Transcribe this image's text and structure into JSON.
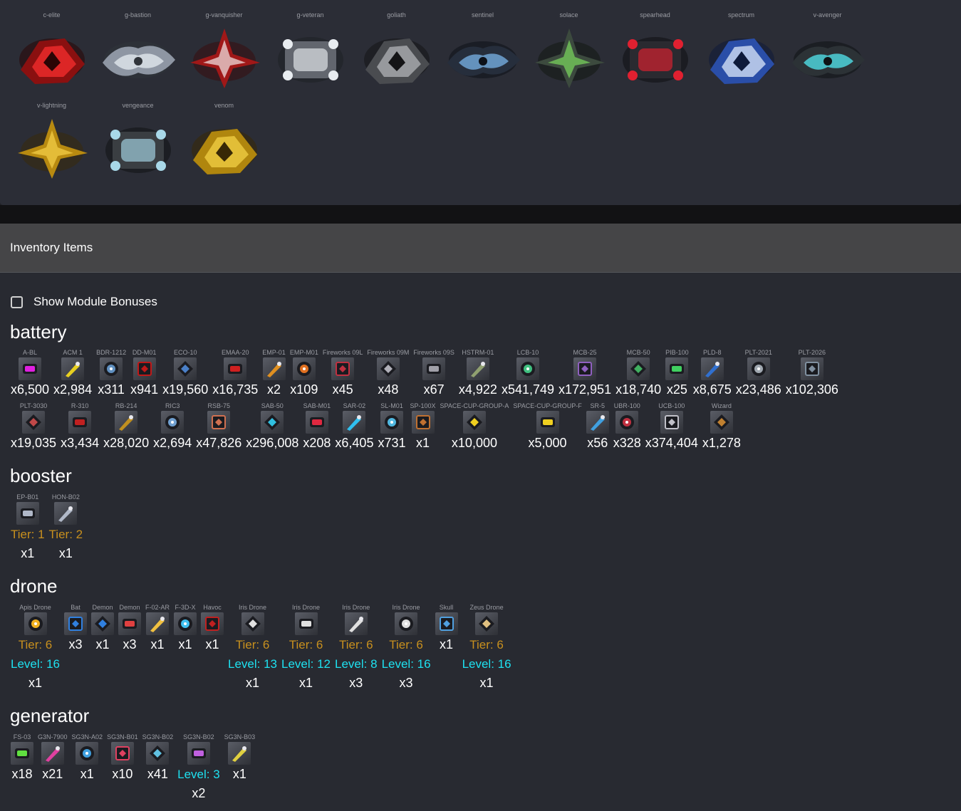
{
  "ships": [
    {
      "name": "c-elite",
      "colors": [
        "#8a1010",
        "#ff3030",
        "#2a0505"
      ],
      "icon": "ship-c-elite-icon"
    },
    {
      "name": "g-bastion",
      "colors": [
        "#8e96a3",
        "#e6ecf2",
        "#30343a"
      ],
      "icon": "ship-g-bastion-icon"
    },
    {
      "name": "g-vanquisher",
      "colors": [
        "#a01818",
        "#f2e8e8",
        "#3a0a0a"
      ],
      "icon": "ship-g-vanquisher-icon"
    },
    {
      "name": "g-veteran",
      "colors": [
        "#62666e",
        "#e8ecf0",
        "#1e2024"
      ],
      "icon": "ship-g-veteran-icon"
    },
    {
      "name": "goliath",
      "colors": [
        "#4a4c50",
        "#b8babe",
        "#141416"
      ],
      "icon": "ship-goliath-icon"
    },
    {
      "name": "sentinel",
      "colors": [
        "#262e3c",
        "#7ab4e8",
        "#0c1018"
      ],
      "icon": "ship-sentinel-icon"
    },
    {
      "name": "solace",
      "colors": [
        "#3c4a3e",
        "#7ad85e",
        "#10160e"
      ],
      "icon": "ship-solace-icon"
    },
    {
      "name": "spearhead",
      "colors": [
        "#2a2a30",
        "#e02030",
        "#0e0e12"
      ],
      "icon": "ship-spearhead-icon"
    },
    {
      "name": "spectrum",
      "colors": [
        "#2a4ea8",
        "#e8f2ff",
        "#0e1a3a"
      ],
      "icon": "ship-spectrum-icon"
    },
    {
      "name": "v-avenger",
      "colors": [
        "#2c3236",
        "#52e8f0",
        "#0e1214"
      ],
      "icon": "ship-v-avenger-icon"
    },
    {
      "name": "v-lightning",
      "colors": [
        "#b88a10",
        "#f6d24a",
        "#3a2a06"
      ],
      "icon": "ship-v-lightning-icon"
    },
    {
      "name": "vengeance",
      "colors": [
        "#3a3e42",
        "#a8d8e8",
        "#101214"
      ],
      "icon": "ship-vengeance-icon"
    },
    {
      "name": "venom",
      "colors": [
        "#b0860e",
        "#f8d648",
        "#382806"
      ],
      "icon": "ship-venom-icon"
    }
  ],
  "inventory": {
    "title": "Inventory Items",
    "show_bonuses_label": "Show Module Bonuses"
  },
  "categories": [
    {
      "title": "battery",
      "rows": [
        [
          {
            "name": "A-BL",
            "qty": "x6,500",
            "color": "#e020e0",
            "icon": "a-bl-icon"
          },
          {
            "name": "ACM 1",
            "qty": "x2,984",
            "color": "#e8d020",
            "icon": "acm-1-icon"
          },
          {
            "name": "BDR-1212",
            "qty": "x311",
            "color": "#6090c0",
            "icon": "bdr-1212-icon"
          },
          {
            "name": "DD-M01",
            "qty": "x941",
            "color": "#c01818",
            "icon": "dd-m01-icon"
          },
          {
            "name": "ECO-10",
            "qty": "x19,560",
            "color": "#4a80c8",
            "icon": "eco-10-icon"
          },
          {
            "name": "EMAA-20",
            "qty": "x16,735",
            "color": "#d02020",
            "icon": "emaa-20-icon"
          },
          {
            "name": "EMP-01",
            "qty": "x2",
            "color": "#e09020",
            "icon": "emp-01-icon"
          },
          {
            "name": "EMP-M01",
            "qty": "x109",
            "color": "#e07020",
            "icon": "emp-m01-icon"
          },
          {
            "name": "Fireworks 09L",
            "qty": "x45",
            "color": "#c03040",
            "icon": "fireworks-09l-icon"
          },
          {
            "name": "Fireworks 09M",
            "qty": "x48",
            "color": "#b0b0b8",
            "icon": "fireworks-09m-icon"
          },
          {
            "name": "Fireworks 09S",
            "qty": "x67",
            "color": "#a0a0a8",
            "icon": "fireworks-09s-icon"
          },
          {
            "name": "HSTRM-01",
            "qty": "x4,922",
            "color": "#90a070",
            "icon": "hstrm-01-icon"
          },
          {
            "name": "LCB-10",
            "qty": "x541,749",
            "color": "#40c080",
            "icon": "lcb-10-icon"
          },
          {
            "name": "MCB-25",
            "qty": "x172,951",
            "color": "#9060c0",
            "icon": "mcb-25-icon"
          },
          {
            "name": "MCB-50",
            "qty": "x18,740",
            "color": "#40b060",
            "icon": "mcb-50-icon"
          },
          {
            "name": "PIB-100",
            "qty": "x25",
            "color": "#40d060",
            "icon": "pib-100-icon"
          },
          {
            "name": "PLD-8",
            "qty": "x8,675",
            "color": "#3070d0",
            "icon": "pld-8-icon"
          },
          {
            "name": "PLT-2021",
            "qty": "x23,486",
            "color": "#a0a8b0",
            "icon": "plt-2021-icon"
          },
          {
            "name": "PLT-2026",
            "qty": "x102,306",
            "color": "#8090a0",
            "icon": "plt-2026-icon"
          }
        ],
        [
          {
            "name": "PLT-3030",
            "qty": "x19,035",
            "color": "#c04848",
            "icon": "plt-3030-icon"
          },
          {
            "name": "R-310",
            "qty": "x3,434",
            "color": "#c02020",
            "icon": "r-310-icon"
          },
          {
            "name": "RB-214",
            "qty": "x28,020",
            "color": "#c09020",
            "icon": "rb-214-icon"
          },
          {
            "name": "RIC3",
            "qty": "x2,694",
            "color": "#70a0d0",
            "icon": "ric3-icon"
          },
          {
            "name": "RSB-75",
            "qty": "x47,826",
            "color": "#d07050",
            "icon": "rsb-75-icon"
          },
          {
            "name": "SAB-50",
            "qty": "x296,008",
            "color": "#30c0e0",
            "icon": "sab-50-icon"
          },
          {
            "name": "SAB-M01",
            "qty": "x208",
            "color": "#e02840",
            "icon": "sab-m01-icon"
          },
          {
            "name": "SAR-02",
            "qty": "x6,405",
            "color": "#30c0f0",
            "icon": "sar-02-icon"
          },
          {
            "name": "SL-M01",
            "qty": "x731",
            "color": "#50b8e0",
            "icon": "sl-m01-icon"
          },
          {
            "name": "SP-100X",
            "qty": "x1",
            "color": "#c07030",
            "icon": "sp-100x-icon"
          },
          {
            "name": "SPACE-CUP-GROUP-A",
            "qty": "x10,000",
            "color": "#f0d020",
            "icon": "space-cup-group-a-icon"
          },
          {
            "name": "SPACE-CUP-GROUP-F",
            "qty": "x5,000",
            "color": "#f0d020",
            "icon": "space-cup-group-f-icon"
          },
          {
            "name": "SR-5",
            "qty": "x56",
            "color": "#40a0e0",
            "icon": "sr-5-icon"
          },
          {
            "name": "UBR-100",
            "qty": "x328",
            "color": "#c03040",
            "icon": "ubr-100-icon"
          },
          {
            "name": "UCB-100",
            "qty": "x374,404",
            "color": "#c0c0c8",
            "icon": "ucb-100-icon"
          },
          {
            "name": "Wizard",
            "qty": "x1,278",
            "color": "#c08030",
            "icon": "wizard-icon"
          }
        ]
      ]
    },
    {
      "title": "booster",
      "rows": [
        [
          {
            "name": "EP-B01",
            "tier": "Tier: 1",
            "qty": "x1",
            "color": "#b0b8c8",
            "icon": "ep-b01-icon"
          },
          {
            "name": "HON-B02",
            "tier": "Tier: 2",
            "qty": "x1",
            "color": "#b0b8c8",
            "icon": "hon-b02-icon"
          }
        ]
      ]
    },
    {
      "title": "drone",
      "rows": [
        [
          {
            "name": "Apis Drone",
            "tier": "Tier: 6",
            "level": "Level: 16",
            "qty": "x1",
            "color": "#f0b020",
            "icon": "apis-drone-icon"
          },
          {
            "name": "Bat",
            "qty": "x3",
            "color": "#3080e0",
            "icon": "bat-drone-icon"
          },
          {
            "name": "Demon",
            "qty": "x1",
            "color": "#3080e0",
            "icon": "demon-drone-icon"
          },
          {
            "name": "Demon",
            "qty": "x3",
            "color": "#e04040",
            "icon": "demon-red-drone-icon"
          },
          {
            "name": "F-02-AR",
            "qty": "x1",
            "color": "#f0c040",
            "icon": "f-02-ar-icon"
          },
          {
            "name": "F-3D-X",
            "qty": "x1",
            "color": "#40c0f0",
            "icon": "f-3d-x-icon"
          },
          {
            "name": "Havoc",
            "qty": "x1",
            "color": "#c02020",
            "icon": "havoc-icon"
          },
          {
            "name": "Iris Drone",
            "tier": "Tier: 6",
            "level": "Level: 13",
            "qty": "x1",
            "color": "#e0e0e0",
            "icon": "iris-drone-icon"
          },
          {
            "name": "Iris Drone",
            "tier": "Tier: 6",
            "level": "Level: 12",
            "qty": "x1",
            "color": "#e0e0e0",
            "icon": "iris-drone-icon"
          },
          {
            "name": "Iris Drone",
            "tier": "Tier: 6",
            "level": "Level: 8",
            "qty": "x3",
            "color": "#e0e0e0",
            "icon": "iris-drone-icon"
          },
          {
            "name": "Iris Drone",
            "tier": "Tier: 6",
            "level": "Level: 16",
            "qty": "x3",
            "color": "#e0e0e0",
            "icon": "iris-drone-icon"
          },
          {
            "name": "Skull",
            "qty": "x1",
            "color": "#50a0e0",
            "icon": "skull-drone-icon"
          },
          {
            "name": "Zeus Drone",
            "tier": "Tier: 6",
            "level": "Level: 16",
            "qty": "x1",
            "color": "#e0c080",
            "icon": "zeus-drone-icon"
          }
        ]
      ]
    },
    {
      "title": "generator",
      "rows": [
        [
          {
            "name": "FS-03",
            "qty": "x18",
            "color": "#60e040",
            "icon": "fs-03-icon"
          },
          {
            "name": "G3N-7900",
            "qty": "x21",
            "color": "#e040a0",
            "icon": "g3n-7900-icon"
          },
          {
            "name": "SG3N-A02",
            "qty": "x1",
            "color": "#40a0e0",
            "icon": "sg3n-a02-icon"
          },
          {
            "name": "SG3N-B01",
            "qty": "x10",
            "color": "#e04060",
            "icon": "sg3n-b01-icon"
          },
          {
            "name": "SG3N-B02",
            "qty": "x41",
            "color": "#60c0e0",
            "icon": "sg3n-b02-icon"
          },
          {
            "name": "SG3N-B02",
            "level": "Level: 3",
            "qty": "x2",
            "color": "#c060e0",
            "icon": "sg3n-b02-icon"
          },
          {
            "name": "SG3N-B03",
            "qty": "x1",
            "color": "#e0d040",
            "icon": "sg3n-b03-icon"
          }
        ]
      ]
    }
  ]
}
